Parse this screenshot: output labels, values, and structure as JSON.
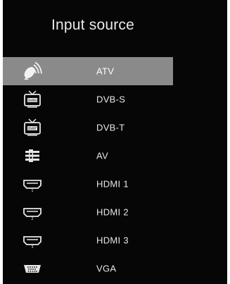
{
  "title": "Input source",
  "sources": [
    {
      "label": "ATV",
      "icon": "satellite-dish-icon",
      "selected": true
    },
    {
      "label": "DVB-S",
      "icon": "tv-dvbs-icon",
      "badge": "DVBS",
      "selected": false
    },
    {
      "label": "DVB-T",
      "icon": "tv-dvbt-icon",
      "badge": "DVBT",
      "selected": false
    },
    {
      "label": "AV",
      "icon": "av-connector-icon",
      "selected": false
    },
    {
      "label": "HDMI 1",
      "icon": "hdmi-port-icon",
      "badge": "1",
      "selected": false
    },
    {
      "label": "HDMI 2",
      "icon": "hdmi-port-icon",
      "badge": "2",
      "selected": false
    },
    {
      "label": "HDMI 3",
      "icon": "hdmi-port-icon",
      "badge": "3",
      "selected": false
    },
    {
      "label": "VGA",
      "icon": "vga-port-icon",
      "selected": false
    }
  ]
}
